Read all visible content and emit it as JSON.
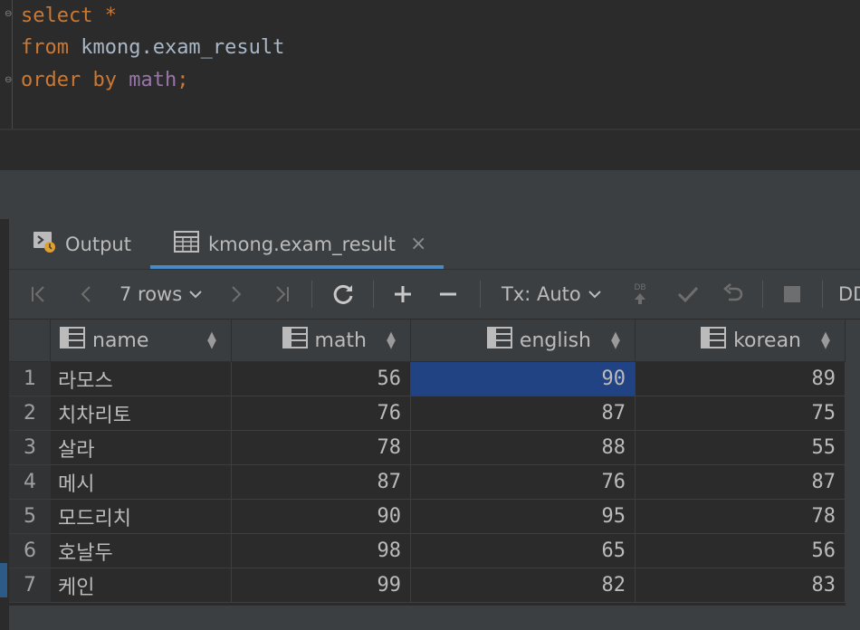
{
  "editor": {
    "lines": [
      {
        "t1": "select",
        "t2": " *",
        "t3": "",
        "t4": ""
      },
      {
        "t1": "from",
        "t2": " kmong.exam_result",
        "t3": "",
        "t4": ""
      },
      {
        "t1": "order by",
        "t2": " ",
        "t3": "math",
        "t4": ";"
      }
    ]
  },
  "tabs": {
    "output": "Output",
    "result": "kmong.exam_result",
    "close": "×"
  },
  "toolbar": {
    "rows_label": "7 rows",
    "tx_label": "Tx: Auto",
    "ddl_label": "DD",
    "db_label": "DB"
  },
  "icons": {
    "first": "first-page-icon",
    "prev": "previous-page-icon",
    "next": "next-page-icon",
    "last": "last-page-icon",
    "refresh": "refresh-icon",
    "add": "add-row-icon",
    "remove": "remove-row-icon",
    "commit": "commit-icon",
    "rollback": "rollback-icon",
    "stop": "stop-icon"
  },
  "grid": {
    "columns": [
      "name",
      "math",
      "english",
      "korean"
    ],
    "rows": [
      {
        "num": "1",
        "name": "라모스",
        "math": "56",
        "english": "90",
        "korean": "89"
      },
      {
        "num": "2",
        "name": "치차리토",
        "math": "76",
        "english": "87",
        "korean": "75"
      },
      {
        "num": "3",
        "name": "살라",
        "math": "78",
        "english": "88",
        "korean": "55"
      },
      {
        "num": "4",
        "name": "메시",
        "math": "87",
        "english": "76",
        "korean": "87"
      },
      {
        "num": "5",
        "name": "모드리치",
        "math": "90",
        "english": "95",
        "korean": "78"
      },
      {
        "num": "6",
        "name": "호날두",
        "math": "98",
        "english": "65",
        "korean": "56"
      },
      {
        "num": "7",
        "name": "케인",
        "math": "99",
        "english": "82",
        "korean": "83"
      }
    ]
  },
  "colors": {
    "selected_cell": "#214283",
    "keyword": "#cc7832",
    "column_ref": "#9876aa",
    "tab_underline": "#4a88c7"
  }
}
